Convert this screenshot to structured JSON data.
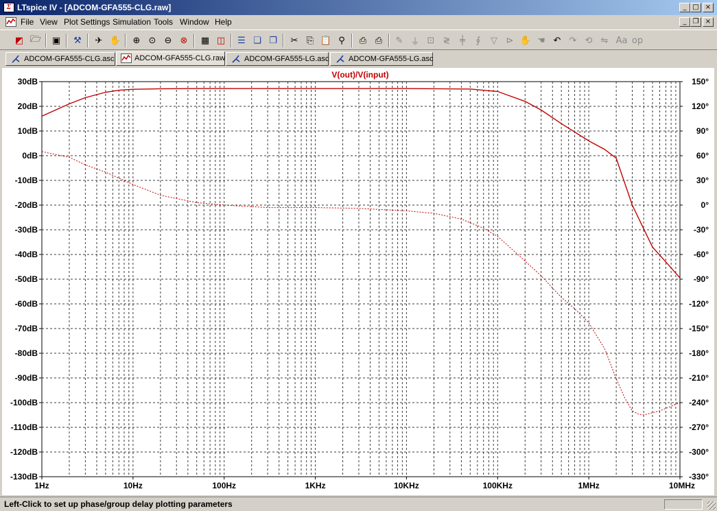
{
  "window": {
    "title": "LTspice IV - [ADCOM-GFA555-CLG.raw]",
    "app_icon_glyph": "Σ"
  },
  "menu": {
    "items": [
      "File",
      "View",
      "Plot Settings",
      "Simulation",
      "Tools",
      "Window",
      "Help"
    ]
  },
  "tabs": [
    {
      "label": "ADCOM-GFA555-CLG.asc",
      "icon": "schematic-icon",
      "active": false
    },
    {
      "label": "ADCOM-GFA555-CLG.raw",
      "icon": "waveform-icon",
      "active": true
    },
    {
      "label": "ADCOM-GFA555-LG.asc",
      "icon": "schematic-icon",
      "active": false
    },
    {
      "label": "ADCOM-GFA555-LG.asc",
      "icon": "schematic-icon",
      "active": false
    }
  ],
  "status": {
    "text": "Left-Click to set up phase/group delay plotting parameters"
  },
  "colors": {
    "trace": "#c00000",
    "grid": "#3a3a3a",
    "titlebar_start": "#0a246a",
    "titlebar_end": "#a6caf0"
  },
  "chart_data": {
    "type": "line",
    "title": "V(out)/V(input)",
    "x_scale": "log",
    "xlim": [
      1,
      10000000
    ],
    "x_ticks": [
      {
        "value": 1,
        "label": "1Hz"
      },
      {
        "value": 10,
        "label": "10Hz"
      },
      {
        "value": 100,
        "label": "100Hz"
      },
      {
        "value": 1000,
        "label": "1KHz"
      },
      {
        "value": 10000,
        "label": "10KHz"
      },
      {
        "value": 100000,
        "label": "100KHz"
      },
      {
        "value": 1000000,
        "label": "1MHz"
      },
      {
        "value": 10000000,
        "label": "10MHz"
      }
    ],
    "y_left": {
      "unit": "dB",
      "lim": [
        -130,
        30
      ],
      "step": 10,
      "tick_labels": [
        "30dB",
        "20dB",
        "10dB",
        "0dB",
        "-10dB",
        "-20dB",
        "-30dB",
        "-40dB",
        "-50dB",
        "-60dB",
        "-70dB",
        "-80dB",
        "-90dB",
        "-100dB",
        "-110dB",
        "-120dB",
        "-130dB"
      ]
    },
    "y_right": {
      "unit": "°",
      "lim": [
        -330,
        150
      ],
      "step": 30,
      "tick_labels": [
        "150°",
        "120°",
        "90°",
        "60°",
        "30°",
        "0°",
        "-30°",
        "-60°",
        "-90°",
        "-120°",
        "-150°",
        "-180°",
        "-210°",
        "-240°",
        "-270°",
        "-300°",
        "-330°"
      ]
    },
    "grid": true,
    "series": [
      {
        "axis": "left",
        "style": "solid",
        "x": [
          1,
          2,
          3,
          5,
          7,
          10,
          20,
          50,
          100,
          1000,
          10000,
          50000,
          100000,
          200000,
          300000,
          500000,
          1000000,
          1500000,
          2000000,
          3000000,
          5000000,
          7000000,
          10000000
        ],
        "y": [
          16,
          21,
          23.5,
          25.7,
          26.5,
          26.9,
          27.1,
          27.2,
          27.2,
          27.2,
          27.2,
          27.0,
          26.0,
          22.0,
          18.5,
          13.0,
          6.0,
          2.5,
          -1.0,
          -20.0,
          -37.0,
          -43.0,
          -49.5
        ]
      },
      {
        "axis": "right",
        "style": "dashed",
        "x": [
          1,
          2,
          3,
          5,
          10,
          20,
          30,
          50,
          100,
          300,
          1000,
          3000,
          10000,
          20000,
          40000,
          70000,
          100000,
          200000,
          300000,
          500000,
          700000,
          1000000,
          1500000,
          2000000,
          2500000,
          3000000,
          3500000,
          4000000,
          6000000,
          10000000
        ],
        "y": [
          65,
          58,
          49,
          40,
          25,
          12,
          8,
          3,
          0,
          -3,
          -3,
          -4,
          -7,
          -10,
          -17,
          -28,
          -38,
          -68,
          -86,
          -112,
          -126,
          -143,
          -175,
          -211,
          -235,
          -250,
          -254,
          -255,
          -250,
          -240
        ]
      }
    ]
  }
}
